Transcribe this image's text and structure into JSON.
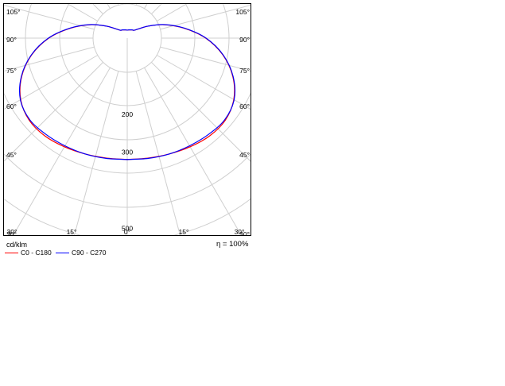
{
  "chart_data": {
    "type": "polar",
    "title": "",
    "unit_label": "cd/klm",
    "efficiency_label": "η = 100%",
    "angle_labels": {
      "left": [
        "105°",
        "90°",
        "75°",
        "60°",
        "45°",
        "30°"
      ],
      "right": [
        "105°",
        "90°",
        "75°",
        "60°",
        "45°",
        "30°"
      ],
      "bottom": [
        "30°",
        "15°",
        "0°",
        "15°",
        "30°"
      ]
    },
    "radial_ticks": [
      {
        "label": "200",
        "value": 200
      },
      {
        "label": "300",
        "value": 300
      },
      {
        "label": "500",
        "value": 500
      }
    ],
    "series": [
      {
        "name": "C0 - C180",
        "color": "#ff0000",
        "angles_deg": [
          0,
          10,
          20,
          30,
          40,
          50,
          60,
          70,
          80,
          90,
          100,
          110,
          120,
          130,
          140,
          150,
          160,
          170,
          180
        ],
        "intensity_cd_klm": [
          319,
          320,
          324,
          330,
          336,
          336,
          323,
          295,
          255,
          206,
          151,
          103,
          63,
          37,
          27,
          25,
          23,
          22,
          21
        ]
      },
      {
        "name": "C90 - C270",
        "color": "#0000ff",
        "angles_deg": [
          0,
          10,
          20,
          30,
          40,
          50,
          60,
          70,
          80,
          90,
          100,
          110,
          120,
          130,
          140,
          150,
          160,
          170,
          180
        ],
        "intensity_cd_klm": [
          319,
          321,
          324,
          327,
          331,
          334,
          324,
          296,
          256,
          207,
          152,
          104,
          63,
          37,
          27,
          25,
          23,
          22,
          21
        ]
      }
    ]
  }
}
